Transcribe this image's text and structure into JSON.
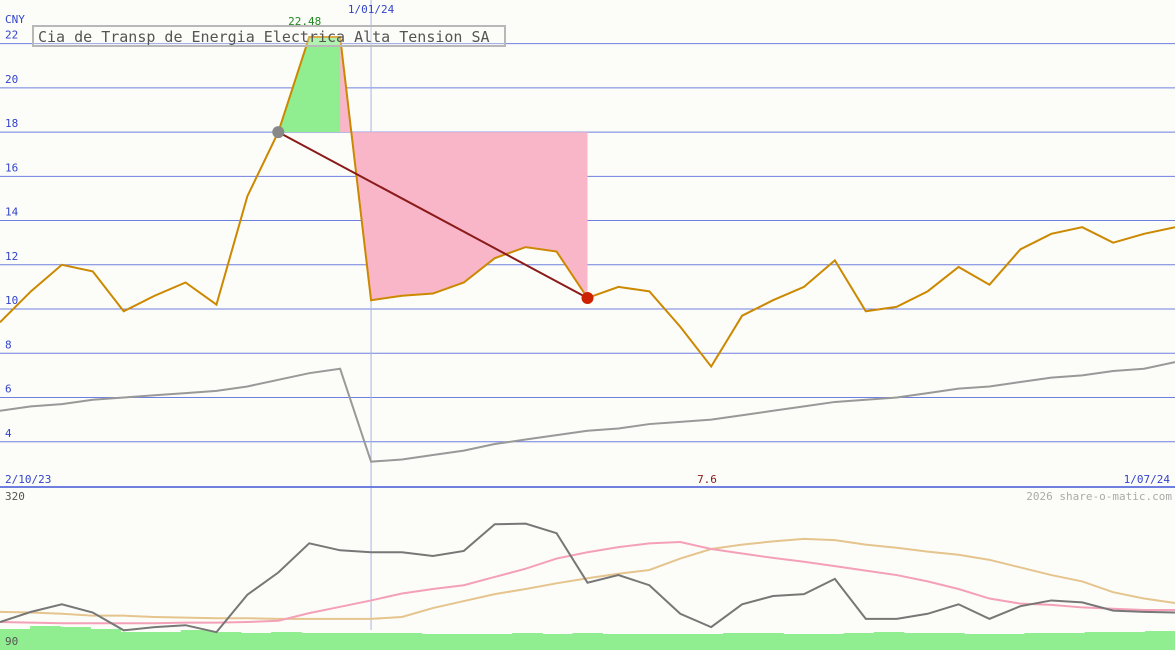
{
  "chart_data": [
    {
      "type": "line",
      "title": "Cia de Transp de Energia Electrica Alta Tension SA",
      "currency_label": "CNY",
      "ylim": [
        2,
        23
      ],
      "y_ticks": [
        "4",
        "6",
        "8",
        "10",
        "12",
        "14",
        "16",
        "18",
        "20",
        "22"
      ],
      "grid": true,
      "x_start_label": "2/10/23",
      "x_end_label": "1/07/24",
      "marker_date_label": "1/01/24",
      "peak_label": "22.48",
      "center_value_label": "7.6",
      "watermark": "2026 share-o-matic.com",
      "colors": {
        "price": "#cc8800",
        "trend_line": "#8b1a1a",
        "gain_fill": "#90ee90",
        "loss_fill": "#f8b6c8",
        "secondary": "#999999",
        "grid": "#6f7fdf",
        "axis_text": "#3344cc"
      },
      "series": [
        {
          "key": "price",
          "values": [
            9.4,
            10.8,
            12.0,
            11.7,
            9.9,
            10.6,
            11.2,
            10.2,
            15.1,
            18.0,
            22.3,
            22.3,
            10.4,
            10.6,
            10.7,
            11.2,
            12.3,
            12.8,
            12.6,
            10.5,
            11.0,
            10.8,
            9.2,
            7.4,
            9.7,
            10.4,
            11.0,
            12.2,
            9.9,
            10.1,
            10.8,
            11.9,
            11.1,
            12.7,
            13.4,
            13.7,
            13.0,
            13.4,
            13.7
          ]
        },
        {
          "key": "secondary",
          "values": [
            5.4,
            5.6,
            5.7,
            5.9,
            6.0,
            6.1,
            6.2,
            6.3,
            6.5,
            6.8,
            7.1,
            7.3,
            3.1,
            3.2,
            3.4,
            3.6,
            3.9,
            4.1,
            4.3,
            4.5,
            4.6,
            4.8,
            4.9,
            5.0,
            5.2,
            5.4,
            5.6,
            5.8,
            5.9,
            6.0,
            6.2,
            6.4,
            6.5,
            6.7,
            6.9,
            7.0,
            7.2,
            7.3,
            7.6
          ]
        }
      ],
      "trade": {
        "buy": 18.0,
        "sell": 10.5,
        "high": 22.48
      }
    },
    {
      "type": "line",
      "ylim": [
        90,
        320
      ],
      "y_ticks": [
        "90",
        "320"
      ],
      "series": [
        {
          "key": "oscillator",
          "values": [
            112,
            128,
            140,
            127,
            99,
            104,
            107,
            96,
            155,
            190,
            236,
            225,
            222,
            222,
            216,
            224,
            266,
            267,
            252,
            174,
            186,
            170,
            125,
            104,
            140,
            153,
            156,
            180,
            117,
            117,
            125,
            140,
            117,
            137,
            146,
            143,
            130,
            128,
            127
          ]
        },
        {
          "key": "ma_fast",
          "values": [
            112,
            111,
            110,
            110,
            110,
            110,
            111,
            111,
            112,
            114,
            126,
            136,
            146,
            157,
            164,
            170,
            183,
            196,
            212,
            222,
            230,
            236,
            238,
            227,
            220,
            213,
            207,
            200,
            193,
            186,
            176,
            164,
            149,
            141,
            139,
            135,
            133,
            131,
            131
          ]
        },
        {
          "key": "ma_slow",
          "values": [
            128,
            127,
            125,
            122,
            122,
            120,
            119,
            118,
            118,
            117,
            117,
            117,
            117,
            120,
            134,
            145,
            156,
            164,
            173,
            181,
            188,
            194,
            212,
            227,
            234,
            239,
            243,
            241,
            234,
            229,
            223,
            218,
            210,
            198,
            186,
            176,
            159,
            149,
            142
          ]
        },
        {
          "key": "volume",
          "values": [
            21,
            24,
            23,
            21,
            18,
            18,
            20,
            18,
            17,
            18,
            17,
            17,
            17,
            17,
            16,
            16,
            16,
            17,
            16,
            17,
            16,
            16,
            16,
            16,
            17,
            17,
            16,
            16,
            17,
            18,
            17,
            17,
            16,
            16,
            17,
            17,
            18,
            18,
            19
          ]
        }
      ],
      "colors": {
        "oscillator": "#777777",
        "ma_fast": "#f4a0b8",
        "ma_slow": "#e5c48e",
        "volume": "#90ee90"
      }
    }
  ]
}
